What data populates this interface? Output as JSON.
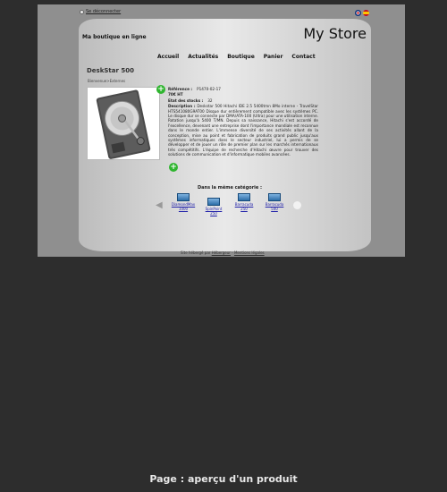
{
  "header": {
    "logout_label": "Se déconnecter",
    "tagline": "Ma boutique en ligne",
    "store_name": "My Store",
    "languages": [
      "english",
      "español"
    ]
  },
  "nav": {
    "items": [
      "Accueil",
      "Actualités",
      "Boutique",
      "Panier",
      "Contact"
    ]
  },
  "product": {
    "title": "DeskStar 500",
    "breadcrumb": "Bienvenue>Externes",
    "reference_label": "Référence :",
    "reference_value": "P1470-02-17",
    "price": "70€ HT",
    "stock_label": "Etat des stocks :",
    "stock_value": "32",
    "description_label": "Description :",
    "description": "Deskstar 500 Hitachi IDE 2.5 5400tmn 8Mo interne - TravelStar HTS541080G9AT00 Disque dur entièrement compatible avec les systèmes PC. Le disque dur se connecte par DMA/ATA-100 (UItra) pour une utilisation interne. Rotation jusqu'à 5400 T/MN. Depuis sa naissance, Hitachi s'est accordé de l'excellence, devenant une entreprise dont l'importance mondiale est reconnue dans le monde entier. L'immense diversité de ses activités allant de la conception, mise au point et fabrication de produits grand public jusqu'aux systèmes informatiques dans le secteur industriel, lui a permis de se développer et de jouer un rôle de premier plan sur les marchés internationaux très compétitifs. L'équipe de recherche d'Hitachi œuvre pour trouver des solutions de communication et d'informatique mobiles avancées."
  },
  "related": {
    "title": "Dans la même catégorie :",
    "items": [
      "DiamondMax 1000",
      "SpinPoint 250",
      "Barracuda 250",
      "Barracuda 500"
    ]
  },
  "footer": {
    "prefix": "Site hébergé par",
    "host": "Hébergeur",
    "legal": "Mentions légales"
  },
  "caption": "Page : aperçu d'un produit"
}
